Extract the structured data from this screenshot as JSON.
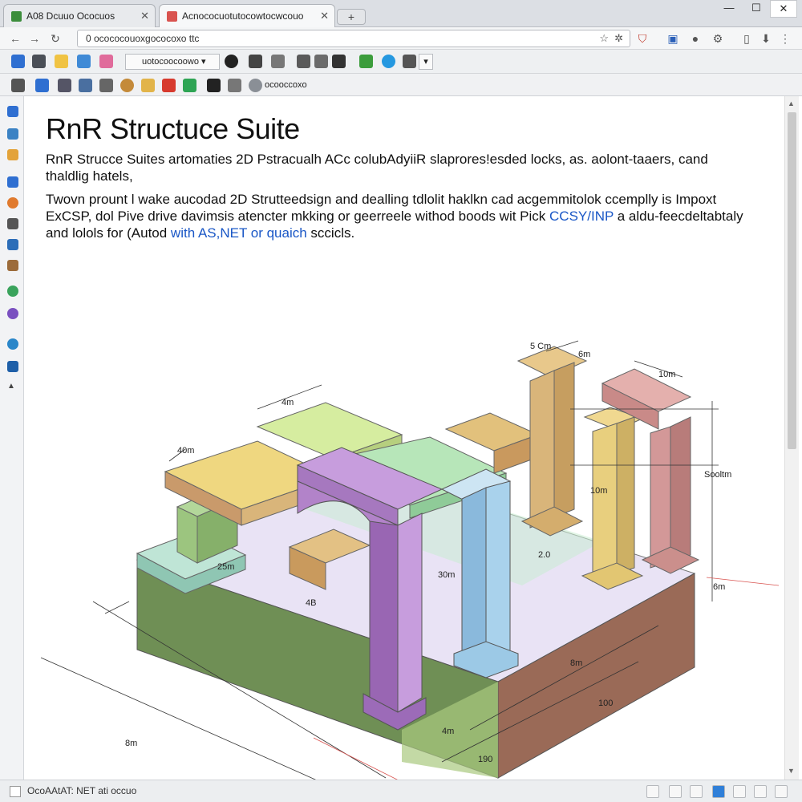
{
  "tabs": [
    {
      "title": "A08 Dcuuo Ococuos",
      "favicon_color": "#3c8d3c"
    },
    {
      "title": "Acnococuotutocowtocwcouo",
      "favicon_color": "#d9534f"
    }
  ],
  "window": {
    "minimize": "—",
    "maximize": "☐",
    "close": "✕",
    "new_tab": "+"
  },
  "address_bar": {
    "url": "0 ocococouoxgococoxo ttc"
  },
  "bookmarks": {
    "dropdown_label": "uotocoocoowo"
  },
  "toolbar2": {
    "field_label": "ocooccoxo"
  },
  "page": {
    "title": "RnR Structuce Suite",
    "paragraph1": "RnR Strucce Suites artomaties 2D  Pstracualh ACc colubAdyiiR slaprores!esded locks, as. aolont-taaers, cand thaldlig hatels,",
    "paragraph2_a": "Twovn prount l wake aucodad 2D Strutteedsign and dealling tdlolit haklkn cad acgemmitolok ccemplly is Impoxt ExCSP, dol Pive drive davimsis atencter mkking or geerreele withod boods wit Pick ",
    "paragraph2_link1": "CCSY/INP",
    "paragraph2_b": " a aldu-feecdeltabtaly and lolols for (Autod ",
    "paragraph2_link2": "with AS,NET or quaich",
    "paragraph2_c": " sccicls."
  },
  "diagram": {
    "dim_labels": [
      "Sooltm",
      "6m",
      "5 Cm",
      "6m",
      "10m",
      "10m",
      "190",
      "100",
      "5m",
      "8m",
      "4m",
      "8m",
      "2.0",
      "4B",
      "25m",
      "30m",
      "40m",
      "4m"
    ],
    "colors": {
      "base_green": "#6f8f55",
      "base_brown": "#9a6a57",
      "slab": "#e9e3f5",
      "purple": "#b283c9",
      "blue": "#9cc9e6",
      "yellow": "#e8cf7e",
      "tan": "#d9b57a",
      "pink": "#d39898",
      "mint": "#b7e6b9",
      "lime": "#d6eda0"
    }
  },
  "status": {
    "text": "OcoAAtAT: NET ati occuo"
  }
}
